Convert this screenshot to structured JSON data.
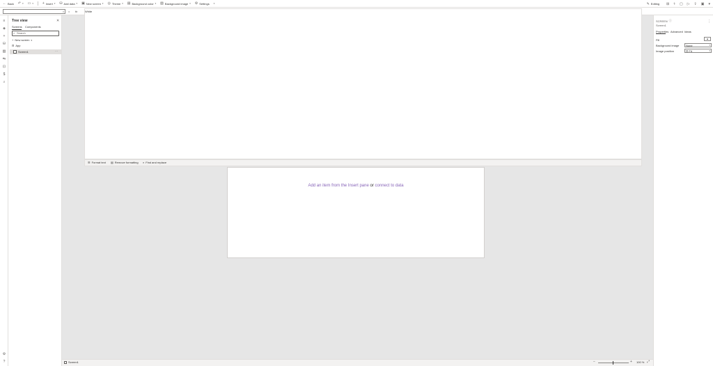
{
  "toolbar": {
    "back": "Back",
    "insert": "Insert",
    "add_data": "Add data",
    "new_screen": "New screen",
    "theme": "Theme",
    "background_color": "Background color",
    "background_image": "Background image",
    "settings": "Settings",
    "editing": "Editing"
  },
  "formula_bar": {
    "property_value": "",
    "equals": "=",
    "fx": "fx",
    "formula": "White"
  },
  "tree_view": {
    "title": "Tree view",
    "tabs": [
      "Screens",
      "Components"
    ],
    "search_placeholder": "Search",
    "new_screen": "New screen",
    "app_item": "App",
    "screen_item": "Screen1"
  },
  "editor_toolbar": {
    "format_text": "Format text",
    "remove_formatting": "Remove formatting",
    "find_replace": "Find and replace"
  },
  "canvas": {
    "message_part1": "Add an item from the Insert pane",
    "message_or": "or",
    "message_link": "connect to data"
  },
  "properties_panel": {
    "type_label": "SCREEN",
    "name": "Screen1",
    "tabs": [
      "Properties",
      "Advanced",
      "Ideas"
    ],
    "fill_label": "Fill",
    "background_image_label": "Background image",
    "background_image_value": "None",
    "image_position_label": "Image position",
    "image_position_value": "Fit"
  },
  "status_bar": {
    "screen_label": "Screen1",
    "zoom_minus": "−",
    "zoom_plus": "+",
    "zoom_value": "100 %"
  }
}
